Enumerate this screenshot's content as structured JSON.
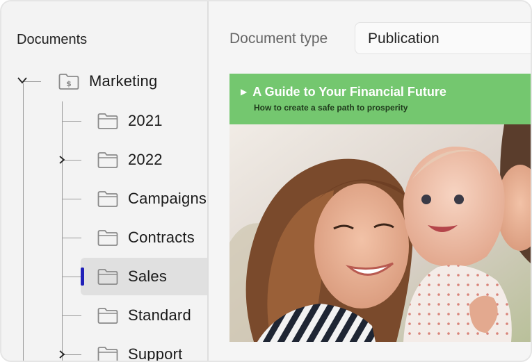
{
  "sidebar": {
    "title": "Documents",
    "root": {
      "label": "Marketing",
      "expanded": true
    },
    "items": [
      {
        "label": "2021",
        "expandable": false
      },
      {
        "label": "2022",
        "expandable": true
      },
      {
        "label": "Campaigns",
        "expandable": false
      },
      {
        "label": "Contracts",
        "expandable": false
      },
      {
        "label": "Sales",
        "expandable": false,
        "selected": true
      },
      {
        "label": "Standard",
        "expandable": false
      },
      {
        "label": "Support",
        "expandable": true
      }
    ]
  },
  "main": {
    "document_type_label": "Document type",
    "document_type_value": "Publication",
    "publication": {
      "title": "A Guide to Your Financial Future",
      "subtitle": "How to create a safe path to prosperity",
      "banner_color": "#74c76f"
    }
  },
  "colors": {
    "selection_accent": "#1f1fb8"
  }
}
